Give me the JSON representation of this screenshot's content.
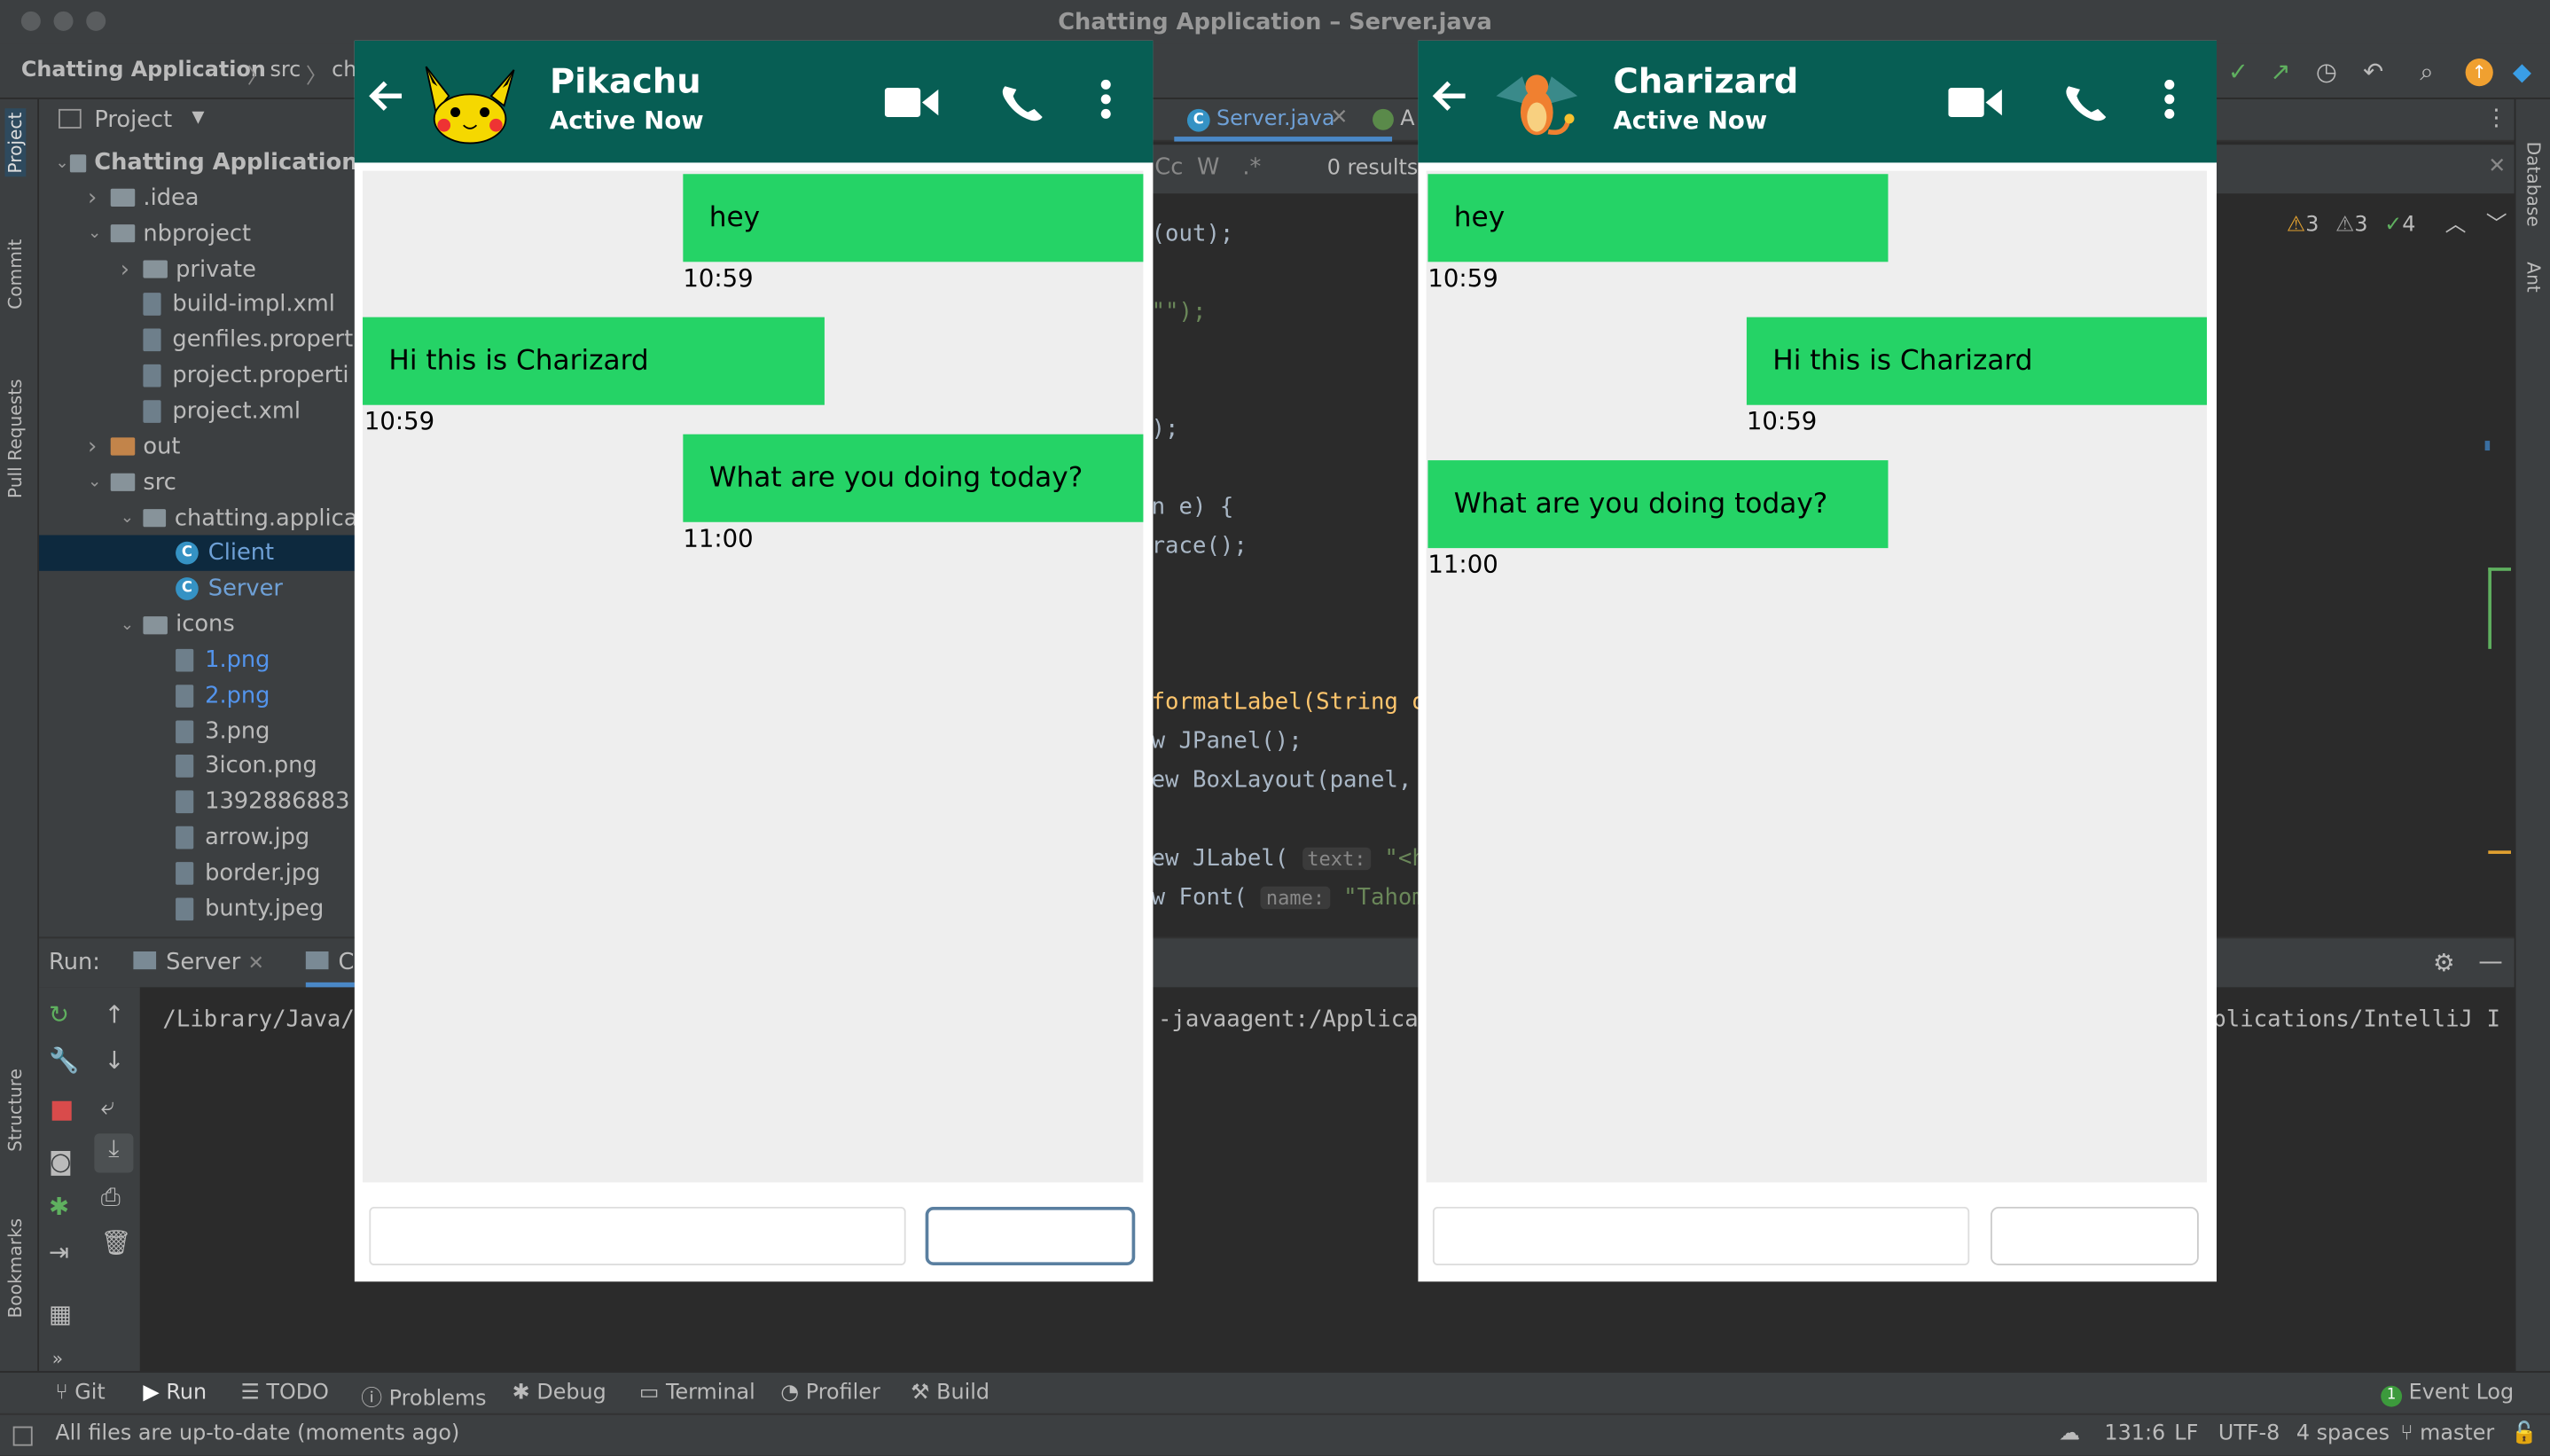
{
  "window": {
    "title": "Chatting Application – Server.java"
  },
  "breadcrumb": {
    "project": "Chatting Application",
    "src": "src",
    "pkg": "ch"
  },
  "project_panel": {
    "header": "Project",
    "tree": [
      {
        "label": "Chatting Application",
        "level": 0,
        "type": "folder",
        "expanded": true
      },
      {
        "label": ".idea",
        "level": 1,
        "type": "folder",
        "expanded": false
      },
      {
        "label": "nbproject",
        "level": 1,
        "type": "folder",
        "expanded": true
      },
      {
        "label": "private",
        "level": 2,
        "type": "folder",
        "expanded": false
      },
      {
        "label": "build-impl.xml",
        "level": 2,
        "type": "file"
      },
      {
        "label": "genfiles.propert",
        "level": 2,
        "type": "file"
      },
      {
        "label": "project.properti",
        "level": 2,
        "type": "file"
      },
      {
        "label": "project.xml",
        "level": 2,
        "type": "file"
      },
      {
        "label": "out",
        "level": 1,
        "type": "folder-orange",
        "expanded": false
      },
      {
        "label": "src",
        "level": 1,
        "type": "folder",
        "expanded": true
      },
      {
        "label": "chatting.applica",
        "level": 2,
        "type": "package",
        "expanded": true
      },
      {
        "label": "Client",
        "level": 3,
        "type": "class",
        "selected": true
      },
      {
        "label": "Server",
        "level": 3,
        "type": "class"
      },
      {
        "label": "icons",
        "level": 2,
        "type": "package",
        "expanded": true
      },
      {
        "label": "1.png",
        "level": 3,
        "type": "image",
        "color": "#5394ec"
      },
      {
        "label": "2.png",
        "level": 3,
        "type": "image",
        "color": "#5394ec"
      },
      {
        "label": "3.png",
        "level": 3,
        "type": "image"
      },
      {
        "label": "3icon.png",
        "level": 3,
        "type": "image"
      },
      {
        "label": "1392886883",
        "level": 3,
        "type": "image"
      },
      {
        "label": "arrow.jpg",
        "level": 3,
        "type": "image"
      },
      {
        "label": "border.jpg",
        "level": 3,
        "type": "image"
      },
      {
        "label": "bunty.jpeg",
        "level": 3,
        "type": "image"
      }
    ]
  },
  "left_strip": {
    "project": "Project",
    "commit": "Commit",
    "pull_requests": "Pull Requests",
    "structure": "Structure",
    "bookmarks": "Bookmarks"
  },
  "right_strip": {
    "database": "Database",
    "ant": "Ant"
  },
  "editor": {
    "tab_active": "Server.java",
    "tab_other": "A",
    "find_cc": "Cc",
    "find_w": "W",
    "find_regex": ".*",
    "find_results": "0 results",
    "inspections": {
      "warnings": "3",
      "weak_warnings": "3",
      "ok": "4"
    },
    "code_lines": [
      {
        "text": "(out);"
      },
      {
        "text": "\"\");"
      },
      {
        "text": ");"
      },
      {
        "text": "n e) {"
      },
      {
        "text": "race();"
      },
      {
        "text": "formatLabel(String o"
      },
      {
        "text": "w JPanel();"
      },
      {
        "text": "ew BoxLayout(panel,"
      },
      {
        "text": "ew JLabel("
      },
      {
        "text": "w Font("
      }
    ],
    "hint_text": "text:",
    "hint_text_value": "\"<htm",
    "hint_name": "name:",
    "hint_name_value": "\"Tahoma"
  },
  "run_panel": {
    "label": "Run:",
    "tab_server": "Server",
    "tab_client": "C",
    "console_left": "/Library/Java/",
    "console_mid": "-javaagent:/Applica",
    "console_right": "pplications/IntelliJ I"
  },
  "bottom_tabs": [
    "Git",
    "Run",
    "TODO",
    "Problems",
    "Debug",
    "Terminal",
    "Profiler",
    "Build"
  ],
  "event_log": "Event Log",
  "event_log_count": "1",
  "status": {
    "message": "All files are up-to-date (moments ago)",
    "position": "131:6",
    "line_sep": "LF",
    "encoding": "UTF-8",
    "indent": "4 spaces",
    "branch": "master"
  },
  "chat_left": {
    "name": "Pikachu",
    "status": "Active Now",
    "messages": [
      {
        "text": "hey",
        "time": "10:59",
        "side": "right"
      },
      {
        "text": "Hi this is Charizard",
        "time": "10:59",
        "side": "left"
      },
      {
        "text": "What are you doing today?",
        "time": "11:00",
        "side": "right"
      }
    ]
  },
  "chat_right": {
    "name": "Charizard",
    "status": "Active Now",
    "messages": [
      {
        "text": "hey",
        "time": "10:59",
        "side": "left"
      },
      {
        "text": "Hi this is Charizard",
        "time": "10:59",
        "side": "right"
      },
      {
        "text": "What are you doing today?",
        "time": "11:00",
        "side": "left"
      }
    ]
  },
  "colors": {
    "chat_header": "#075e54",
    "bubble": "#25d366",
    "chat_bg": "#eeeeee",
    "ide_bg": "#2b2b2b",
    "ide_panel": "#3c3f41"
  },
  "icons": [
    "back-arrow-icon",
    "video-call-icon",
    "phone-icon",
    "more-vert-icon"
  ]
}
